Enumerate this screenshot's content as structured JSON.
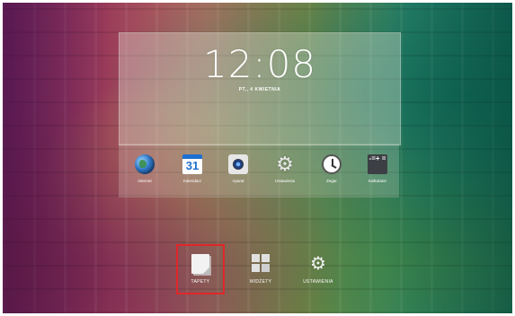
{
  "clock": {
    "time": "12:08",
    "date": "PT., 4 KWIETNIA"
  },
  "apps": [
    {
      "label": "Internet",
      "icon": "globe-icon"
    },
    {
      "label": "Kalendarz",
      "icon": "calendar-icon",
      "badge": "31"
    },
    {
      "label": "Aparat",
      "icon": "camera-icon"
    },
    {
      "label": "Ustawienia",
      "icon": "gear-icon"
    },
    {
      "label": "Zegar",
      "icon": "clock-icon"
    },
    {
      "label": "Kalkulator",
      "icon": "calculator-icon",
      "glyph": "-=+ ="
    }
  ],
  "bottom_menu": [
    {
      "label": "TAPETY",
      "icon": "wallpaper-icon",
      "highlighted": true
    },
    {
      "label": "WIDŻETY",
      "icon": "widgets-icon"
    },
    {
      "label": "USTAWIENIA",
      "icon": "settings-icon"
    }
  ],
  "colors": {
    "highlight": "#e0262a"
  }
}
